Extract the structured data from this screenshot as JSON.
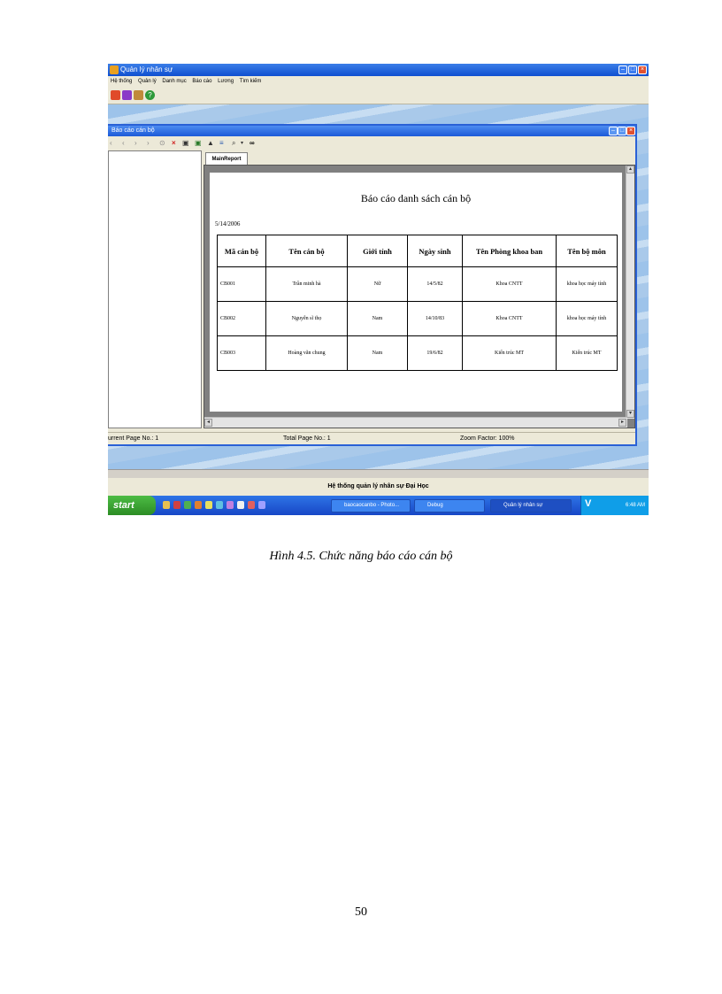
{
  "app": {
    "title": "Quản lý nhân sự",
    "menu": [
      "Hệ thống",
      "Quản lý",
      "Danh mục",
      "Báo cáo",
      "Lương",
      "Tìm kiếm"
    ],
    "toolbar_icons": [
      "red-icon",
      "purple-icon",
      "people-icon",
      "help-icon"
    ]
  },
  "report_window": {
    "title": "Báo cáo cán bộ",
    "tab": "MainReport",
    "report_title": "Báo cáo danh sách cán bộ",
    "date": "5/14/2006",
    "columns": [
      "Mã cán bộ",
      "Tên cán bộ",
      "Giới tính",
      "Ngày sinh",
      "Tên Phòng khoa ban",
      "Tên bộ môn"
    ],
    "rows": [
      [
        "CB001",
        "Trần minh hà",
        "Nữ",
        "14/5/82",
        "Khoa CNTT",
        "khoa học máy tính"
      ],
      [
        "CB002",
        "Nguyễn sĩ thọ",
        "Nam",
        "14/10/83",
        "Khoa CNTT",
        "khoa học máy tính"
      ],
      [
        "CB003",
        "Hoàng văn chung",
        "Nam",
        "19/6/82",
        "Kiến trúc MT",
        "Kiến trúc MT"
      ]
    ],
    "status": {
      "current_page": "urrent Page No.: 1",
      "total_page": "Total Page No.: 1",
      "zoom": "Zoom Factor: 100%"
    }
  },
  "app_status": "Hệ thống quản lý nhân sự Đại Học",
  "taskbar": {
    "start": "start",
    "tasks": [
      "baocaocanbo - Photo...",
      "Debug",
      "Quản lý nhân sự"
    ],
    "tray_label": "V",
    "clock": "6:48 AM"
  },
  "caption": "Hình 4.5. Chức năng báo cáo cán bộ",
  "page_number": "50",
  "colors": {
    "titlebar": "#0f4fd0",
    "taskbar": "#1747c6",
    "start": "#2c8c24",
    "window_bg": "#ece9d8"
  }
}
